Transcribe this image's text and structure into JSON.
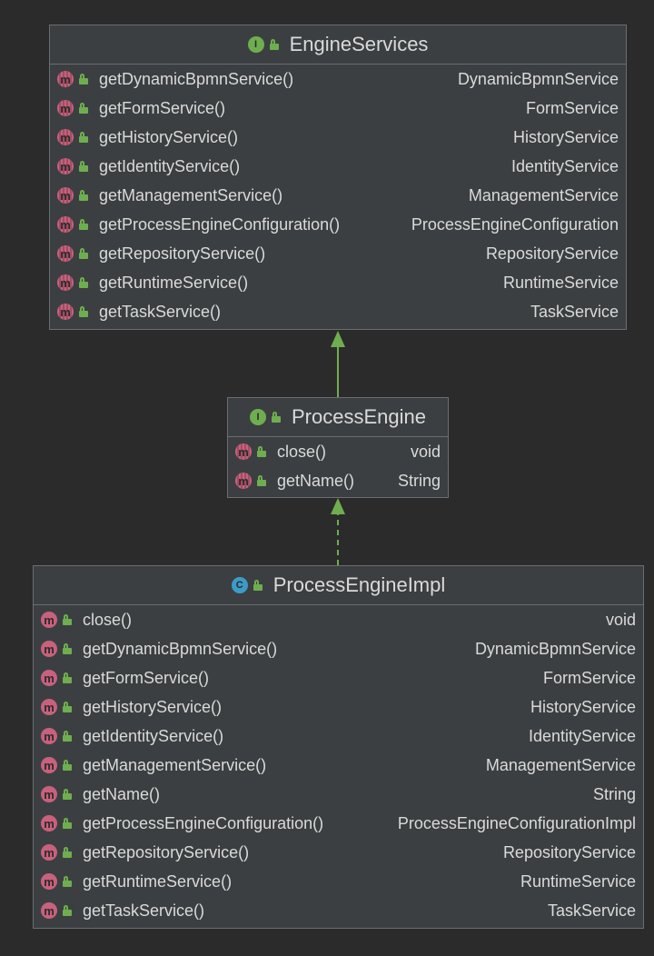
{
  "engine_services": {
    "title": "EngineServices",
    "kind_icon": "interface-icon",
    "members": [
      {
        "name": "getDynamicBpmnService()",
        "type": "DynamicBpmnService"
      },
      {
        "name": "getFormService()",
        "type": "FormService"
      },
      {
        "name": "getHistoryService()",
        "type": "HistoryService"
      },
      {
        "name": "getIdentityService()",
        "type": "IdentityService"
      },
      {
        "name": "getManagementService()",
        "type": "ManagementService"
      },
      {
        "name": "getProcessEngineConfiguration()",
        "type": "ProcessEngineConfiguration"
      },
      {
        "name": "getRepositoryService()",
        "type": "RepositoryService"
      },
      {
        "name": "getRuntimeService()",
        "type": "RuntimeService"
      },
      {
        "name": "getTaskService()",
        "type": "TaskService"
      }
    ]
  },
  "process_engine": {
    "title": "ProcessEngine",
    "kind_icon": "interface-icon",
    "members": [
      {
        "name": "close()",
        "type": "void"
      },
      {
        "name": "getName()",
        "type": "String"
      }
    ]
  },
  "process_engine_impl": {
    "title": "ProcessEngineImpl",
    "kind_icon": "class-icon",
    "members": [
      {
        "name": "close()",
        "type": "void"
      },
      {
        "name": "getDynamicBpmnService()",
        "type": "DynamicBpmnService"
      },
      {
        "name": "getFormService()",
        "type": "FormService"
      },
      {
        "name": "getHistoryService()",
        "type": "HistoryService"
      },
      {
        "name": "getIdentityService()",
        "type": "IdentityService"
      },
      {
        "name": "getManagementService()",
        "type": "ManagementService"
      },
      {
        "name": "getName()",
        "type": "String"
      },
      {
        "name": "getProcessEngineConfiguration()",
        "type": "ProcessEngineConfigurationImpl"
      },
      {
        "name": "getRepositoryService()",
        "type": "RepositoryService"
      },
      {
        "name": "getRuntimeService()",
        "type": "RuntimeService"
      },
      {
        "name": "getTaskService()",
        "type": "TaskService"
      }
    ]
  },
  "icons": {
    "interface_letter": "I",
    "class_letter": "C",
    "method_letter": "m"
  },
  "colors": {
    "background": "#2b2b2b",
    "box": "#3c3f41",
    "border": "#6b6e70",
    "edge": "#6fae4f",
    "method_icon": "#c8617d",
    "interface_icon": "#6fae4f",
    "class_icon": "#3c9cc8"
  }
}
